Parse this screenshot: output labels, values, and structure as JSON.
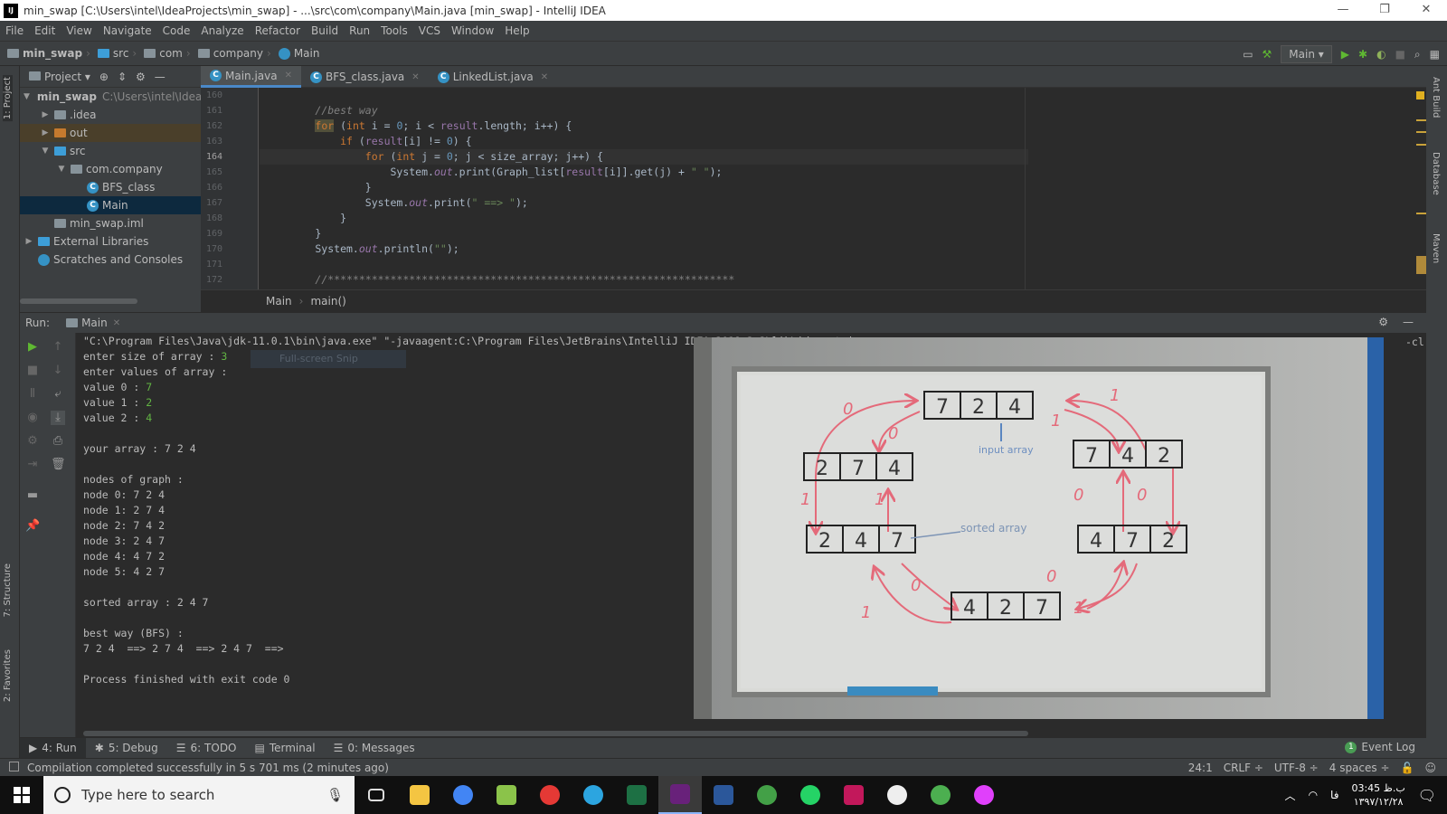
{
  "window": {
    "title": "min_swap [C:\\Users\\intel\\IdeaProjects\\min_swap] - ...\\src\\com\\company\\Main.java [min_swap] - IntelliJ IDEA",
    "logo": "IJ",
    "minimize": "—",
    "maximize": "❐",
    "close": "✕"
  },
  "menu": [
    "File",
    "Edit",
    "View",
    "Navigate",
    "Code",
    "Analyze",
    "Refactor",
    "Build",
    "Run",
    "Tools",
    "VCS",
    "Window",
    "Help"
  ],
  "nav": {
    "crumbs": [
      "min_swap",
      "src",
      "com",
      "company",
      "Main"
    ],
    "run_config": "Main",
    "icons": [
      "layout-icon",
      "build-hammer-icon",
      "run-icon",
      "debug-icon",
      "coverage-icon",
      "stop-icon",
      "search-icon",
      "project-structure-icon"
    ]
  },
  "left_stripe": {
    "project": "1: Project",
    "structure": "7: Structure",
    "favorites": "2: Favorites"
  },
  "right_stripe": {
    "ant": "Ant Build",
    "database": "Database",
    "maven": "Maven"
  },
  "project": {
    "header": "Project",
    "tree": [
      {
        "label": "min_swap",
        "hint": "C:\\Users\\intel\\IdeaProjects\\min_swap",
        "depth": 0,
        "arrow": "▼",
        "icon": "folder",
        "bold": true
      },
      {
        "label": ".idea",
        "depth": 1,
        "arrow": "▶",
        "icon": "folder"
      },
      {
        "label": "out",
        "depth": 1,
        "arrow": "▶",
        "icon": "folder-orange",
        "hl": true
      },
      {
        "label": "src",
        "depth": 1,
        "arrow": "▼",
        "icon": "folder-blue"
      },
      {
        "label": "com.company",
        "depth": 2,
        "arrow": "▼",
        "icon": "package"
      },
      {
        "label": "BFS_class",
        "depth": 3,
        "arrow": "",
        "icon": "class"
      },
      {
        "label": "Main",
        "depth": 3,
        "arrow": "",
        "icon": "class",
        "selected": true
      },
      {
        "label": "min_swap.iml",
        "depth": 1,
        "arrow": "",
        "icon": "file"
      },
      {
        "label": "External Libraries",
        "depth": 0,
        "arrow": "▶",
        "icon": "library"
      },
      {
        "label": "Scratches and Consoles",
        "depth": 0,
        "arrow": "",
        "icon": "scratch"
      }
    ]
  },
  "editor": {
    "tabs": [
      {
        "label": "Main.java",
        "active": true
      },
      {
        "label": "BFS_class.java"
      },
      {
        "label": "LinkedList.java"
      }
    ],
    "current_line": 164,
    "lines": [
      {
        "n": 160,
        "t": []
      },
      {
        "n": 161,
        "t": [
          [
            "        ",
            ""
          ],
          [
            "//best way",
            "cm"
          ]
        ]
      },
      {
        "n": 162,
        "t": [
          [
            "        ",
            ""
          ],
          [
            "for",
            "kwhl"
          ],
          [
            " (",
            ""
          ],
          [
            "int ",
            "kw"
          ],
          [
            "i = ",
            ""
          ],
          [
            "0",
            "num"
          ],
          [
            "; i < ",
            ""
          ],
          [
            "result",
            "fld"
          ],
          [
            ".length; i++) {",
            ""
          ]
        ]
      },
      {
        "n": 163,
        "t": [
          [
            "            ",
            ""
          ],
          [
            "if ",
            "kw"
          ],
          [
            "(",
            ""
          ],
          [
            "result",
            "fld"
          ],
          [
            "[i] != ",
            ""
          ],
          [
            "0",
            "num"
          ],
          [
            ") {",
            ""
          ]
        ]
      },
      {
        "n": 164,
        "t": [
          [
            "                ",
            ""
          ],
          [
            "for ",
            "kw"
          ],
          [
            "(",
            ""
          ],
          [
            "int ",
            "kw"
          ],
          [
            "j = ",
            ""
          ],
          [
            "0",
            "num"
          ],
          [
            "; j < size_array; j++) {",
            ""
          ]
        ]
      },
      {
        "n": 165,
        "t": [
          [
            "                    System.",
            ""
          ],
          [
            "out",
            "st"
          ],
          [
            ".print(Graph_list[",
            ""
          ],
          [
            "result",
            "fld"
          ],
          [
            "[i]].get(j) + ",
            ""
          ],
          [
            "\" \"",
            "str"
          ],
          [
            ");",
            ""
          ]
        ]
      },
      {
        "n": 166,
        "t": [
          [
            "                }",
            ""
          ]
        ]
      },
      {
        "n": 167,
        "t": [
          [
            "                System.",
            ""
          ],
          [
            "out",
            "st"
          ],
          [
            ".print(",
            ""
          ],
          [
            "\" ==> \"",
            "str"
          ],
          [
            ");",
            ""
          ]
        ]
      },
      {
        "n": 168,
        "t": [
          [
            "            }",
            ""
          ]
        ]
      },
      {
        "n": 169,
        "t": [
          [
            "        }",
            ""
          ]
        ]
      },
      {
        "n": 170,
        "t": [
          [
            "        System.",
            ""
          ],
          [
            "out",
            "st"
          ],
          [
            ".println(",
            ""
          ],
          [
            "\"\"",
            "str"
          ],
          [
            ");",
            ""
          ]
        ]
      },
      {
        "n": 171,
        "t": []
      },
      {
        "n": 172,
        "t": [
          [
            "        ",
            ""
          ],
          [
            "//*****************************************************************",
            "cm"
          ]
        ]
      }
    ],
    "breadcrumb": [
      "Main",
      "main()"
    ]
  },
  "run": {
    "label": "Run:",
    "tab": "Main",
    "console": [
      {
        "text": "\"C:\\Program Files\\Java\\jdk-11.0.1\\bin\\java.exe\" \"-javaagent:C:\\Program Files\\JetBrains\\IntelliJ IDEA 2018.3.2\\lib\\idea_rt.jar=",
        "input": ""
      },
      {
        "text": "enter size of array : ",
        "input": "3"
      },
      {
        "text": "enter values of array :",
        "input": ""
      },
      {
        "text": "value 0 : ",
        "input": "7"
      },
      {
        "text": "value 1 : ",
        "input": "2"
      },
      {
        "text": "value 2 : ",
        "input": "4"
      },
      {
        "text": "",
        "input": ""
      },
      {
        "text": "your array : 7 2 4",
        "input": ""
      },
      {
        "text": "",
        "input": ""
      },
      {
        "text": "nodes of graph :",
        "input": ""
      },
      {
        "text": "node 0: 7 2 4",
        "input": ""
      },
      {
        "text": "node 1: 2 7 4",
        "input": ""
      },
      {
        "text": "node 2: 7 4 2",
        "input": ""
      },
      {
        "text": "node 3: 2 4 7",
        "input": ""
      },
      {
        "text": "node 4: 4 7 2",
        "input": ""
      },
      {
        "text": "node 5: 4 2 7",
        "input": ""
      },
      {
        "text": "",
        "input": ""
      },
      {
        "text": "sorted array : 2 4 7",
        "input": ""
      },
      {
        "text": "",
        "input": ""
      },
      {
        "text": "best way (BFS) :",
        "input": ""
      },
      {
        "text": "7 2 4  ==> 2 7 4  ==> 2 4 7  ==>",
        "input": ""
      },
      {
        "text": "",
        "input": ""
      },
      {
        "text": "Process finished with exit code 0",
        "input": ""
      }
    ],
    "overflow_text": "-cl",
    "snip_tooltip": "Full-screen Snip"
  },
  "whiteboard": {
    "nodes": [
      [
        "7",
        "2",
        "4"
      ],
      [
        "2",
        "7",
        "4"
      ],
      [
        "7",
        "4",
        "2"
      ],
      [
        "2",
        "4",
        "7"
      ],
      [
        "4",
        "7",
        "2"
      ],
      [
        "4",
        "2",
        "7"
      ]
    ],
    "notes": {
      "input": "input array",
      "sorted": "sorted array"
    },
    "edge_labels": [
      "0",
      "0",
      "1",
      "1",
      "1",
      "1",
      "0",
      "0",
      "0",
      "1",
      "0",
      "1"
    ]
  },
  "bottom_tabs": [
    {
      "label": "4: Run",
      "icon": "▶",
      "active": true
    },
    {
      "label": "5: Debug",
      "icon": "✱"
    },
    {
      "label": "6: TODO",
      "icon": "☰"
    },
    {
      "label": "Terminal",
      "icon": "▤"
    },
    {
      "label": "0: Messages",
      "icon": "☰"
    }
  ],
  "event_log": {
    "count": "1",
    "label": "Event Log"
  },
  "status": {
    "message": "Compilation completed successfully in 5 s 701 ms (2 minutes ago)",
    "position": "24:1",
    "line_sep": "CRLF ÷",
    "encoding": "UTF-8 ÷",
    "indent": "4 spaces ÷"
  },
  "taskbar": {
    "search_placeholder": "Type here to search",
    "apps": [
      {
        "name": "task-view",
        "color": "#101010"
      },
      {
        "name": "file-explorer",
        "color": "#f4c542"
      },
      {
        "name": "chrome",
        "color": "#4285f4"
      },
      {
        "name": "notepad",
        "color": "#8bc34a"
      },
      {
        "name": "app-red",
        "color": "#e53935"
      },
      {
        "name": "telegram",
        "color": "#2ca5e0"
      },
      {
        "name": "excel",
        "color": "#1d7044"
      },
      {
        "name": "visual-studio",
        "color": "#68217a"
      },
      {
        "name": "word",
        "color": "#2b579a"
      },
      {
        "name": "app-green",
        "color": "#43a047"
      },
      {
        "name": "whatsapp",
        "color": "#25d366"
      },
      {
        "name": "intellij",
        "color": "#c2185b"
      },
      {
        "name": "app-circle",
        "color": "#eeeeee"
      },
      {
        "name": "globe-app",
        "color": "#4caf50"
      },
      {
        "name": "maps",
        "color": "#e040fb"
      }
    ],
    "lang": "فا",
    "time": "03:45 ب.ظ",
    "date": "۱۳۹۷/۱۲/۲۸"
  },
  "colors": {
    "accent": "#4a88c7",
    "input_green": "#62b543",
    "keyword": "#cc7832"
  }
}
